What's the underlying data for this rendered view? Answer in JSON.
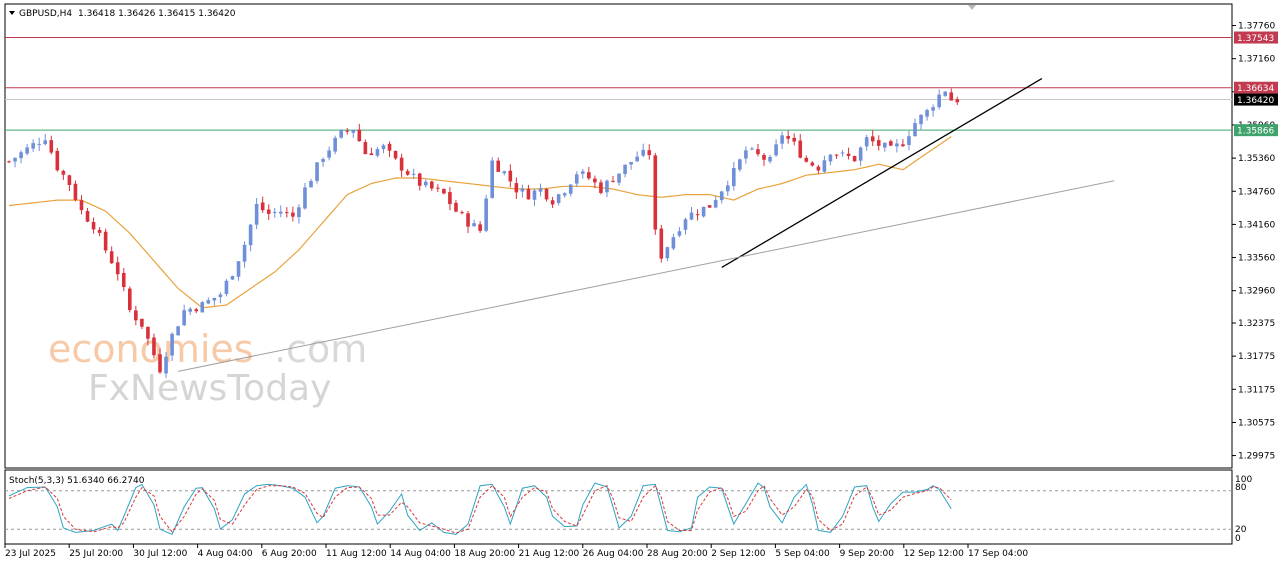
{
  "header": {
    "symbol": "GBPUSD,H4",
    "ohlc": "1.36418 1.36426 1.36415 1.36420"
  },
  "watermark": {
    "part1": "economies",
    "part2": ".com",
    "line2": "FxNewsToday"
  },
  "indicator": {
    "label": "Stoch(5,3,3) 51.6340 66.2740",
    "levels": [
      "100",
      "80",
      "20",
      "0"
    ]
  },
  "colors": {
    "bull": "#6f8fd8",
    "bear": "#d8313b",
    "ma": "#e8a33c",
    "resistance": "#c23a4f",
    "support": "#3fa36b",
    "current": "#000000",
    "stoch_main": "#2fa3c2",
    "stoch_signal": "#d83838"
  },
  "chart_data": {
    "type": "candlestick",
    "title": "GBPUSD,H4",
    "ylim": [
      1.2975,
      1.3815
    ],
    "y_ticks": [
      "1.37760",
      "1.37160",
      "1.36560",
      "1.35960",
      "1.35360",
      "1.34760",
      "1.34160",
      "1.33560",
      "1.32960",
      "1.32375",
      "1.31775",
      "1.31175",
      "1.30575",
      "1.29975"
    ],
    "x_ticks": [
      "23 Jul 2025",
      "25 Jul 20:00",
      "30 Jul 12:00",
      "4 Aug 04:00",
      "6 Aug 20:00",
      "11 Aug 12:00",
      "14 Aug 04:00",
      "18 Aug 20:00",
      "21 Aug 12:00",
      "26 Aug 04:00",
      "28 Aug 20:00",
      "2 Sep 12:00",
      "5 Sep 04:00",
      "9 Sep 20:00",
      "12 Sep 12:00",
      "17 Sep 04:00"
    ],
    "price_labels": [
      {
        "value": 1.37543,
        "text": "1.37543",
        "role": "resistance"
      },
      {
        "value": 1.36634,
        "text": "1.36634",
        "role": "resistance"
      },
      {
        "value": 1.3642,
        "text": "1.36420",
        "role": "current"
      },
      {
        "value": 1.35866,
        "text": "1.35866",
        "role": "support"
      }
    ],
    "close_path": [
      [
        0,
        1.353
      ],
      [
        6,
        1.3575
      ],
      [
        8,
        1.352
      ],
      [
        10,
        1.349
      ],
      [
        12,
        1.344
      ],
      [
        14,
        1.3415
      ],
      [
        16,
        1.337
      ],
      [
        18,
        1.333
      ],
      [
        20,
        1.326
      ],
      [
        22,
        1.3235
      ],
      [
        24,
        1.318
      ],
      [
        25,
        1.3155
      ],
      [
        27,
        1.3215
      ],
      [
        29,
        1.326
      ],
      [
        32,
        1.327
      ],
      [
        35,
        1.329
      ],
      [
        37,
        1.333
      ],
      [
        39,
        1.338
      ],
      [
        41,
        1.345
      ],
      [
        43,
        1.3435
      ],
      [
        45,
        1.344
      ],
      [
        47,
        1.343
      ],
      [
        49,
        1.348
      ],
      [
        52,
        1.354
      ],
      [
        55,
        1.358
      ],
      [
        57,
        1.359
      ],
      [
        59,
        1.3545
      ],
      [
        62,
        1.3555
      ],
      [
        64,
        1.353
      ],
      [
        66,
        1.351
      ],
      [
        68,
        1.349
      ],
      [
        70,
        1.348
      ],
      [
        72,
        1.347
      ],
      [
        74,
        1.344
      ],
      [
        76,
        1.342
      ],
      [
        78,
        1.3405
      ],
      [
        80,
        1.353
      ],
      [
        82,
        1.351
      ],
      [
        84,
        1.348
      ],
      [
        86,
        1.347
      ],
      [
        88,
        1.348
      ],
      [
        90,
        1.346
      ],
      [
        92,
        1.348
      ],
      [
        94,
        1.351
      ],
      [
        96,
        1.35
      ],
      [
        98,
        1.348
      ],
      [
        100,
        1.35
      ],
      [
        102,
        1.352
      ],
      [
        104,
        1.354
      ],
      [
        106,
        1.3545
      ],
      [
        107,
        1.34
      ],
      [
        108,
        1.336
      ],
      [
        110,
        1.3395
      ],
      [
        112,
        1.343
      ],
      [
        114,
        1.344
      ],
      [
        116,
        1.345
      ],
      [
        118,
        1.348
      ],
      [
        120,
        1.351
      ],
      [
        122,
        1.355
      ],
      [
        124,
        1.354
      ],
      [
        126,
        1.353
      ],
      [
        128,
        1.358
      ],
      [
        130,
        1.356
      ],
      [
        132,
        1.353
      ],
      [
        134,
        1.352
      ],
      [
        136,
        1.355
      ],
      [
        138,
        1.354
      ],
      [
        140,
        1.3535
      ],
      [
        142,
        1.357
      ],
      [
        144,
        1.356
      ],
      [
        146,
        1.355
      ],
      [
        148,
        1.3565
      ],
      [
        150,
        1.36
      ],
      [
        152,
        1.362
      ],
      [
        154,
        1.365
      ],
      [
        155,
        1.366
      ],
      [
        156,
        1.3642
      ]
    ],
    "ma_path": [
      [
        0,
        1.345
      ],
      [
        4,
        1.3455
      ],
      [
        8,
        1.346
      ],
      [
        12,
        1.346
      ],
      [
        16,
        1.344
      ],
      [
        20,
        1.34
      ],
      [
        24,
        1.335
      ],
      [
        28,
        1.33
      ],
      [
        32,
        1.3265
      ],
      [
        36,
        1.327
      ],
      [
        40,
        1.33
      ],
      [
        44,
        1.333
      ],
      [
        48,
        1.337
      ],
      [
        52,
        1.342
      ],
      [
        56,
        1.347
      ],
      [
        60,
        1.349
      ],
      [
        64,
        1.35
      ],
      [
        68,
        1.35
      ],
      [
        72,
        1.3495
      ],
      [
        76,
        1.349
      ],
      [
        80,
        1.3485
      ],
      [
        84,
        1.348
      ],
      [
        88,
        1.348
      ],
      [
        92,
        1.3485
      ],
      [
        96,
        1.3485
      ],
      [
        100,
        1.348
      ],
      [
        104,
        1.347
      ],
      [
        108,
        1.3465
      ],
      [
        112,
        1.347
      ],
      [
        116,
        1.347
      ],
      [
        120,
        1.346
      ],
      [
        124,
        1.348
      ],
      [
        128,
        1.349
      ],
      [
        132,
        1.3505
      ],
      [
        136,
        1.351
      ],
      [
        140,
        1.3515
      ],
      [
        144,
        1.3525
      ],
      [
        148,
        1.3515
      ],
      [
        152,
        1.3545
      ],
      [
        156,
        1.3575
      ]
    ],
    "bar_count": 158,
    "trendlines": [
      {
        "from": [
          118,
          1.3338
        ],
        "to": [
          171,
          1.368
        ],
        "color": "#000000"
      },
      {
        "from": [
          28,
          1.315
        ],
        "to": [
          183,
          1.3495
        ],
        "color": "#a0a0a0"
      }
    ],
    "stoch_main": [
      [
        0,
        72
      ],
      [
        3,
        85
      ],
      [
        6,
        86
      ],
      [
        8,
        55
      ],
      [
        9,
        22
      ],
      [
        11,
        15
      ],
      [
        14,
        18
      ],
      [
        17,
        28
      ],
      [
        18,
        18
      ],
      [
        19,
        40
      ],
      [
        21,
        85
      ],
      [
        22,
        90
      ],
      [
        24,
        58
      ],
      [
        25,
        20
      ],
      [
        27,
        12
      ],
      [
        29,
        55
      ],
      [
        31,
        84
      ],
      [
        32,
        85
      ],
      [
        34,
        52
      ],
      [
        35,
        20
      ],
      [
        37,
        35
      ],
      [
        39,
        75
      ],
      [
        41,
        88
      ],
      [
        43,
        90
      ],
      [
        45,
        88
      ],
      [
        47,
        84
      ],
      [
        49,
        70
      ],
      [
        51,
        30
      ],
      [
        52,
        40
      ],
      [
        54,
        84
      ],
      [
        56,
        88
      ],
      [
        58,
        86
      ],
      [
        60,
        55
      ],
      [
        61,
        28
      ],
      [
        63,
        48
      ],
      [
        65,
        75
      ],
      [
        66,
        42
      ],
      [
        68,
        18
      ],
      [
        70,
        30
      ],
      [
        72,
        15
      ],
      [
        74,
        12
      ],
      [
        76,
        28
      ],
      [
        78,
        88
      ],
      [
        80,
        90
      ],
      [
        82,
        55
      ],
      [
        83,
        28
      ],
      [
        85,
        84
      ],
      [
        87,
        88
      ],
      [
        89,
        70
      ],
      [
        90,
        40
      ],
      [
        92,
        24
      ],
      [
        94,
        25
      ],
      [
        95,
        58
      ],
      [
        97,
        92
      ],
      [
        99,
        86
      ],
      [
        100,
        55
      ],
      [
        101,
        22
      ],
      [
        103,
        40
      ],
      [
        105,
        88
      ],
      [
        107,
        90
      ],
      [
        108,
        55
      ],
      [
        109,
        18
      ],
      [
        111,
        16
      ],
      [
        113,
        22
      ],
      [
        114,
        70
      ],
      [
        116,
        86
      ],
      [
        118,
        84
      ],
      [
        119,
        55
      ],
      [
        120,
        28
      ],
      [
        122,
        60
      ],
      [
        124,
        92
      ],
      [
        125,
        85
      ],
      [
        126,
        55
      ],
      [
        128,
        30
      ],
      [
        130,
        70
      ],
      [
        132,
        90
      ],
      [
        133,
        60
      ],
      [
        134,
        18
      ],
      [
        136,
        15
      ],
      [
        138,
        40
      ],
      [
        140,
        86
      ],
      [
        142,
        88
      ],
      [
        143,
        55
      ],
      [
        144,
        32
      ],
      [
        146,
        60
      ],
      [
        148,
        78
      ],
      [
        150,
        78
      ],
      [
        152,
        82
      ],
      [
        153,
        88
      ],
      [
        154,
        82
      ],
      [
        156,
        52
      ]
    ],
    "stoch_signal": [
      [
        0,
        68
      ],
      [
        3,
        80
      ],
      [
        6,
        86
      ],
      [
        8,
        68
      ],
      [
        9,
        40
      ],
      [
        11,
        20
      ],
      [
        14,
        16
      ],
      [
        17,
        24
      ],
      [
        18,
        22
      ],
      [
        19,
        30
      ],
      [
        21,
        70
      ],
      [
        22,
        85
      ],
      [
        24,
        72
      ],
      [
        25,
        40
      ],
      [
        27,
        16
      ],
      [
        29,
        40
      ],
      [
        31,
        75
      ],
      [
        32,
        83
      ],
      [
        34,
        65
      ],
      [
        35,
        35
      ],
      [
        37,
        28
      ],
      [
        39,
        58
      ],
      [
        41,
        82
      ],
      [
        43,
        88
      ],
      [
        45,
        88
      ],
      [
        47,
        86
      ],
      [
        49,
        76
      ],
      [
        51,
        45
      ],
      [
        52,
        38
      ],
      [
        54,
        70
      ],
      [
        56,
        85
      ],
      [
        58,
        86
      ],
      [
        60,
        68
      ],
      [
        61,
        42
      ],
      [
        63,
        42
      ],
      [
        65,
        62
      ],
      [
        66,
        55
      ],
      [
        68,
        30
      ],
      [
        70,
        25
      ],
      [
        72,
        20
      ],
      [
        74,
        14
      ],
      [
        76,
        20
      ],
      [
        78,
        70
      ],
      [
        80,
        88
      ],
      [
        82,
        70
      ],
      [
        83,
        40
      ],
      [
        85,
        70
      ],
      [
        87,
        85
      ],
      [
        89,
        78
      ],
      [
        90,
        52
      ],
      [
        92,
        32
      ],
      [
        94,
        25
      ],
      [
        95,
        42
      ],
      [
        97,
        80
      ],
      [
        99,
        88
      ],
      [
        100,
        68
      ],
      [
        101,
        38
      ],
      [
        103,
        32
      ],
      [
        105,
        70
      ],
      [
        107,
        88
      ],
      [
        108,
        70
      ],
      [
        109,
        32
      ],
      [
        111,
        18
      ],
      [
        113,
        18
      ],
      [
        114,
        50
      ],
      [
        116,
        78
      ],
      [
        118,
        85
      ],
      [
        119,
        68
      ],
      [
        120,
        40
      ],
      [
        122,
        48
      ],
      [
        124,
        80
      ],
      [
        125,
        88
      ],
      [
        126,
        68
      ],
      [
        128,
        42
      ],
      [
        130,
        55
      ],
      [
        132,
        82
      ],
      [
        133,
        72
      ],
      [
        134,
        35
      ],
      [
        136,
        18
      ],
      [
        138,
        28
      ],
      [
        140,
        72
      ],
      [
        142,
        86
      ],
      [
        143,
        68
      ],
      [
        144,
        42
      ],
      [
        146,
        50
      ],
      [
        148,
        70
      ],
      [
        150,
        76
      ],
      [
        152,
        80
      ],
      [
        153,
        86
      ],
      [
        154,
        85
      ],
      [
        156,
        66
      ]
    ]
  }
}
